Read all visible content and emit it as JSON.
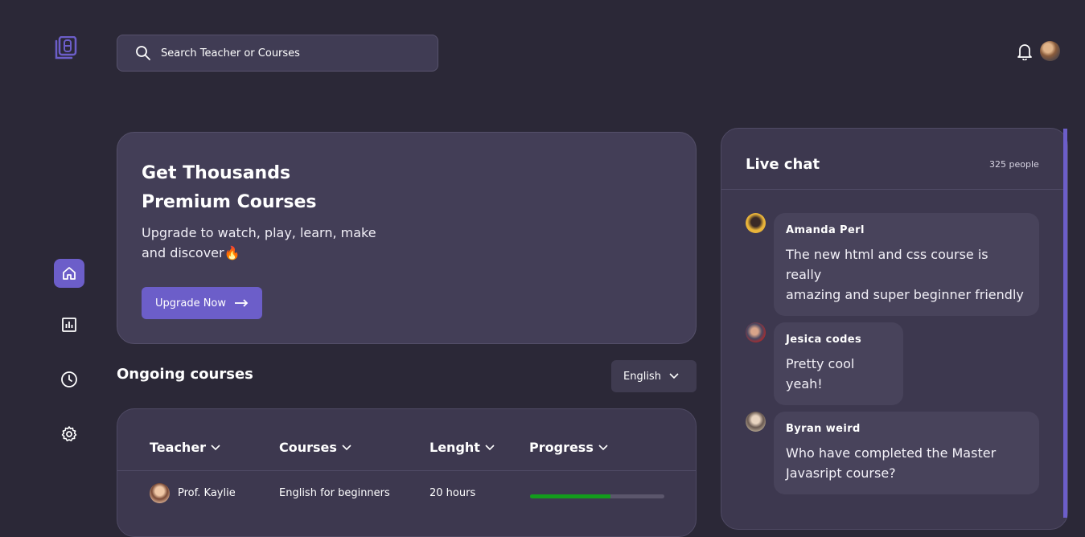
{
  "search": {
    "placeholder": "Search Teacher or Courses"
  },
  "header": {
    "bell_icon": "bell-icon",
    "avatar_icon": "user-avatar"
  },
  "sidebar": {
    "items": [
      {
        "name": "home",
        "icon": "home-icon",
        "active": true
      },
      {
        "name": "stats",
        "icon": "chart-icon",
        "active": false
      },
      {
        "name": "history",
        "icon": "clock-icon",
        "active": false
      },
      {
        "name": "settings",
        "icon": "gear-icon",
        "active": false
      }
    ]
  },
  "hero": {
    "title_line1": "Get Thousands",
    "title_line2": "Premium Courses",
    "subtitle_line1": "Upgrade to watch, play, learn, make",
    "subtitle_line2": "and discover🔥",
    "button_label": "Upgrade Now"
  },
  "courses": {
    "section_title": "Ongoing courses",
    "language": "English",
    "columns": [
      "Teacher",
      "Courses",
      "Lenght",
      "Progress"
    ],
    "rows": [
      {
        "teacher": "Prof. Kaylie",
        "course": "English for beginners",
        "length": "20 hours",
        "progress": 0.6
      }
    ]
  },
  "chat": {
    "title": "Live chat",
    "count": "325 people",
    "messages": [
      {
        "sender": "Amanda Perl",
        "line1": "The new html and css course is really",
        "line2": "amazing and super beginner friendly"
      },
      {
        "sender": "Jesica codes",
        "line1": "Pretty cool yeah!"
      },
      {
        "sender": "Byran weird",
        "line1": "Who have completed the Master",
        "line2": "Javasript course?"
      }
    ]
  },
  "colors": {
    "accent": "#6c5ec9",
    "background": "#2b2837",
    "card": "#433e57",
    "progress": "#139c1c"
  }
}
